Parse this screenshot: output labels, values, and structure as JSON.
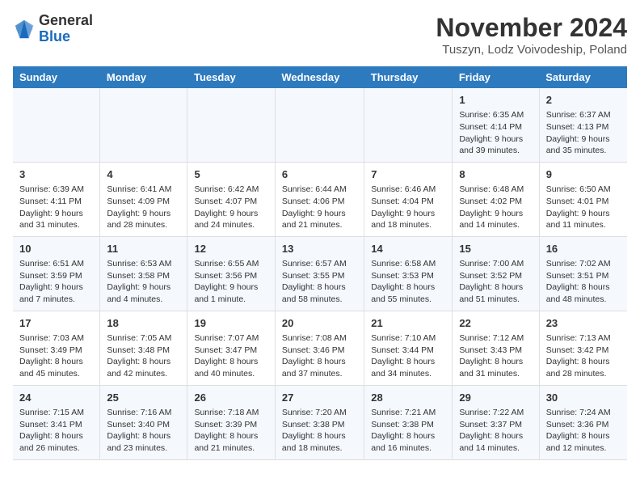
{
  "header": {
    "logo_general": "General",
    "logo_blue": "Blue",
    "month_title": "November 2024",
    "location": "Tuszyn, Lodz Voivodeship, Poland"
  },
  "columns": [
    "Sunday",
    "Monday",
    "Tuesday",
    "Wednesday",
    "Thursday",
    "Friday",
    "Saturday"
  ],
  "weeks": [
    {
      "days": [
        {
          "num": "",
          "text": ""
        },
        {
          "num": "",
          "text": ""
        },
        {
          "num": "",
          "text": ""
        },
        {
          "num": "",
          "text": ""
        },
        {
          "num": "",
          "text": ""
        },
        {
          "num": "1",
          "text": "Sunrise: 6:35 AM\nSunset: 4:14 PM\nDaylight: 9 hours and 39 minutes."
        },
        {
          "num": "2",
          "text": "Sunrise: 6:37 AM\nSunset: 4:13 PM\nDaylight: 9 hours and 35 minutes."
        }
      ]
    },
    {
      "days": [
        {
          "num": "3",
          "text": "Sunrise: 6:39 AM\nSunset: 4:11 PM\nDaylight: 9 hours and 31 minutes."
        },
        {
          "num": "4",
          "text": "Sunrise: 6:41 AM\nSunset: 4:09 PM\nDaylight: 9 hours and 28 minutes."
        },
        {
          "num": "5",
          "text": "Sunrise: 6:42 AM\nSunset: 4:07 PM\nDaylight: 9 hours and 24 minutes."
        },
        {
          "num": "6",
          "text": "Sunrise: 6:44 AM\nSunset: 4:06 PM\nDaylight: 9 hours and 21 minutes."
        },
        {
          "num": "7",
          "text": "Sunrise: 6:46 AM\nSunset: 4:04 PM\nDaylight: 9 hours and 18 minutes."
        },
        {
          "num": "8",
          "text": "Sunrise: 6:48 AM\nSunset: 4:02 PM\nDaylight: 9 hours and 14 minutes."
        },
        {
          "num": "9",
          "text": "Sunrise: 6:50 AM\nSunset: 4:01 PM\nDaylight: 9 hours and 11 minutes."
        }
      ]
    },
    {
      "days": [
        {
          "num": "10",
          "text": "Sunrise: 6:51 AM\nSunset: 3:59 PM\nDaylight: 9 hours and 7 minutes."
        },
        {
          "num": "11",
          "text": "Sunrise: 6:53 AM\nSunset: 3:58 PM\nDaylight: 9 hours and 4 minutes."
        },
        {
          "num": "12",
          "text": "Sunrise: 6:55 AM\nSunset: 3:56 PM\nDaylight: 9 hours and 1 minute."
        },
        {
          "num": "13",
          "text": "Sunrise: 6:57 AM\nSunset: 3:55 PM\nDaylight: 8 hours and 58 minutes."
        },
        {
          "num": "14",
          "text": "Sunrise: 6:58 AM\nSunset: 3:53 PM\nDaylight: 8 hours and 55 minutes."
        },
        {
          "num": "15",
          "text": "Sunrise: 7:00 AM\nSunset: 3:52 PM\nDaylight: 8 hours and 51 minutes."
        },
        {
          "num": "16",
          "text": "Sunrise: 7:02 AM\nSunset: 3:51 PM\nDaylight: 8 hours and 48 minutes."
        }
      ]
    },
    {
      "days": [
        {
          "num": "17",
          "text": "Sunrise: 7:03 AM\nSunset: 3:49 PM\nDaylight: 8 hours and 45 minutes."
        },
        {
          "num": "18",
          "text": "Sunrise: 7:05 AM\nSunset: 3:48 PM\nDaylight: 8 hours and 42 minutes."
        },
        {
          "num": "19",
          "text": "Sunrise: 7:07 AM\nSunset: 3:47 PM\nDaylight: 8 hours and 40 minutes."
        },
        {
          "num": "20",
          "text": "Sunrise: 7:08 AM\nSunset: 3:46 PM\nDaylight: 8 hours and 37 minutes."
        },
        {
          "num": "21",
          "text": "Sunrise: 7:10 AM\nSunset: 3:44 PM\nDaylight: 8 hours and 34 minutes."
        },
        {
          "num": "22",
          "text": "Sunrise: 7:12 AM\nSunset: 3:43 PM\nDaylight: 8 hours and 31 minutes."
        },
        {
          "num": "23",
          "text": "Sunrise: 7:13 AM\nSunset: 3:42 PM\nDaylight: 8 hours and 28 minutes."
        }
      ]
    },
    {
      "days": [
        {
          "num": "24",
          "text": "Sunrise: 7:15 AM\nSunset: 3:41 PM\nDaylight: 8 hours and 26 minutes."
        },
        {
          "num": "25",
          "text": "Sunrise: 7:16 AM\nSunset: 3:40 PM\nDaylight: 8 hours and 23 minutes."
        },
        {
          "num": "26",
          "text": "Sunrise: 7:18 AM\nSunset: 3:39 PM\nDaylight: 8 hours and 21 minutes."
        },
        {
          "num": "27",
          "text": "Sunrise: 7:20 AM\nSunset: 3:38 PM\nDaylight: 8 hours and 18 minutes."
        },
        {
          "num": "28",
          "text": "Sunrise: 7:21 AM\nSunset: 3:38 PM\nDaylight: 8 hours and 16 minutes."
        },
        {
          "num": "29",
          "text": "Sunrise: 7:22 AM\nSunset: 3:37 PM\nDaylight: 8 hours and 14 minutes."
        },
        {
          "num": "30",
          "text": "Sunrise: 7:24 AM\nSunset: 3:36 PM\nDaylight: 8 hours and 12 minutes."
        }
      ]
    }
  ]
}
